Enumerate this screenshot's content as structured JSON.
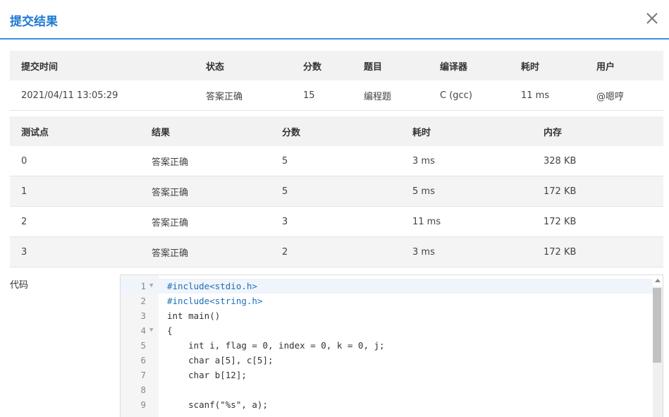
{
  "dialog": {
    "title": "提交结果"
  },
  "summary": {
    "headers": [
      "提交时间",
      "状态",
      "分数",
      "题目",
      "编译器",
      "耗时",
      "用户"
    ],
    "row": [
      "2021/04/11 13:05:29",
      "答案正确",
      "15",
      "编程题",
      "C (gcc)",
      "11 ms",
      "@嗯哼"
    ]
  },
  "cases": {
    "headers": [
      "测试点",
      "结果",
      "分数",
      "耗时",
      "内存"
    ],
    "rows": [
      [
        "0",
        "答案正确",
        "5",
        "3 ms",
        "328 KB"
      ],
      [
        "1",
        "答案正确",
        "5",
        "5 ms",
        "172 KB"
      ],
      [
        "2",
        "答案正确",
        "3",
        "11 ms",
        "172 KB"
      ],
      [
        "3",
        "答案正确",
        "2",
        "3 ms",
        "172 KB"
      ]
    ]
  },
  "code": {
    "label": "代码",
    "line_numbers": [
      "1",
      "2",
      "3",
      "4",
      "5",
      "6",
      "7",
      "8",
      "9"
    ],
    "lines": [
      "#include<stdio.h>",
      "#include<string.h>",
      "int main()",
      "{",
      "    int i, flag = 0, index = 0, k = 0, j;",
      "    char a[5], c[5];",
      "    char b[12];",
      "",
      "    scanf(\"%s\", a);"
    ]
  },
  "colors": {
    "accent": "#1e78d2",
    "success_text": "#d23b3b",
    "header_bg": "#f2f2f2"
  },
  "icons": {
    "close": "close-icon",
    "fold": "fold-arrow-icon"
  }
}
